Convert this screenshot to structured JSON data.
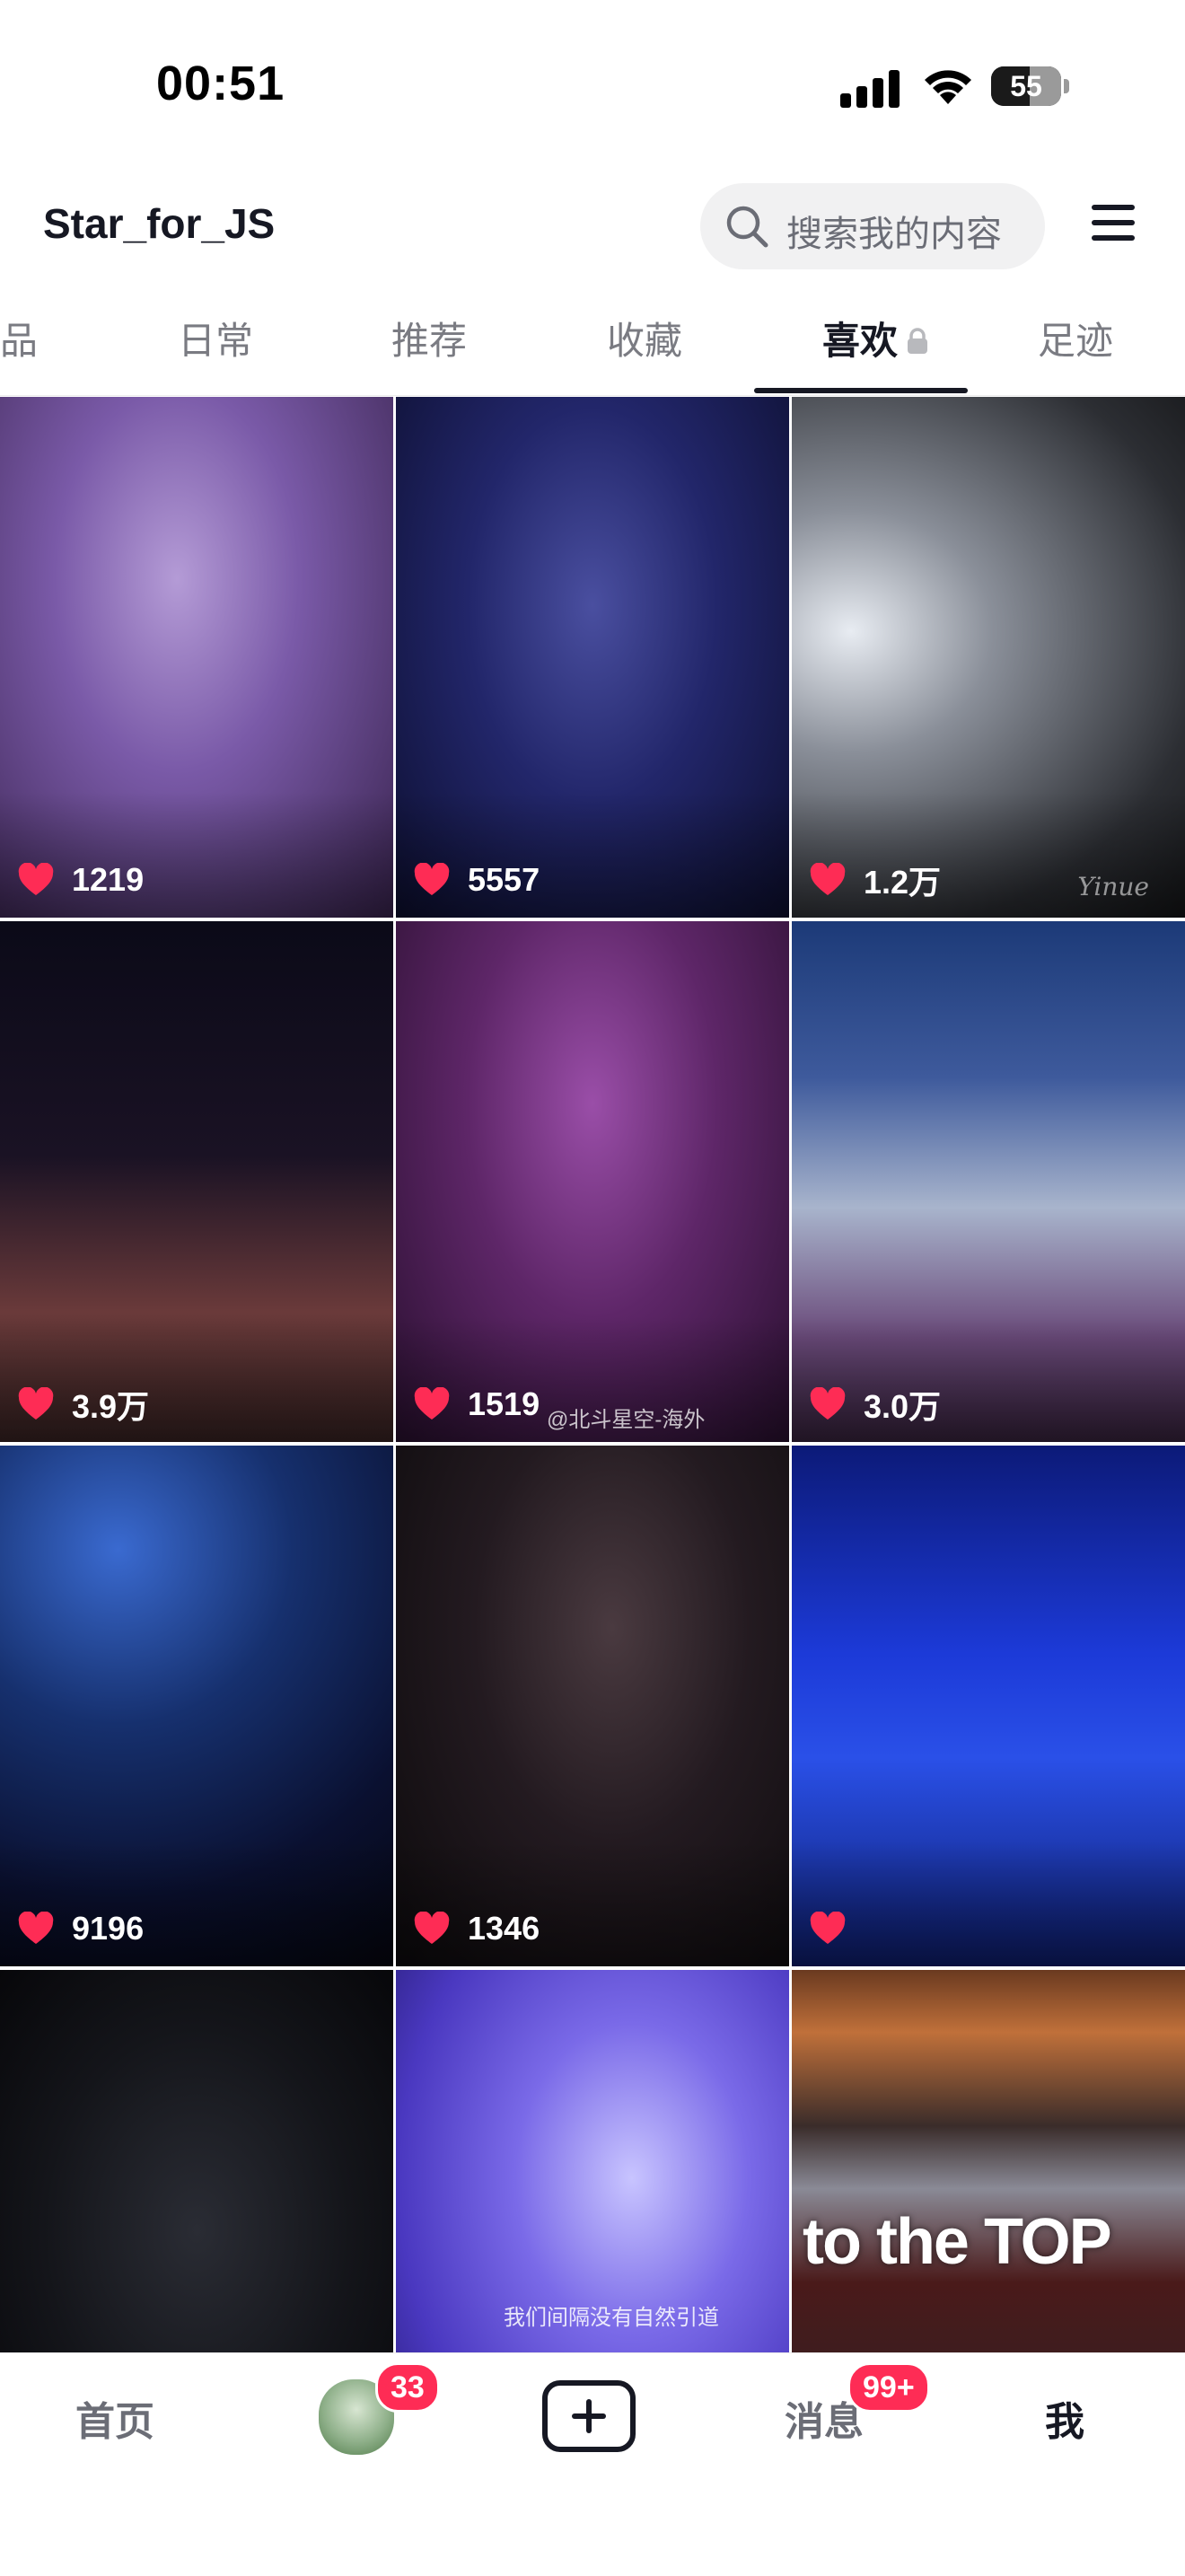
{
  "status_bar": {
    "time": "00:51",
    "battery": "55",
    "battery_level": 0.55
  },
  "header": {
    "username": "Star_for_JS",
    "search_placeholder": "搜索我的内容"
  },
  "tabs": [
    {
      "label": "品",
      "active": false
    },
    {
      "label": "日常",
      "active": false
    },
    {
      "label": "推荐",
      "active": false
    },
    {
      "label": "收藏",
      "active": false
    },
    {
      "label": "喜欢",
      "active": true,
      "locked": true
    },
    {
      "label": "足迹",
      "active": false
    }
  ],
  "grid": {
    "videos": [
      {
        "likes": "1219",
        "theme": "purple-stage"
      },
      {
        "likes": "5557",
        "theme": "blue-stage"
      },
      {
        "likes": "1.2万",
        "theme": "spotlight-gray",
        "watermark": "Yinue"
      },
      {
        "likes": "3.9万",
        "theme": "dark-red-stage"
      },
      {
        "likes": "1519",
        "theme": "purple-dancers",
        "caption": "@北斗星空-海外"
      },
      {
        "likes": "3.0万",
        "theme": "arena-floor"
      },
      {
        "likes": "9196",
        "theme": "blue-lights"
      },
      {
        "likes": "1346",
        "theme": "dark-stage"
      },
      {
        "likes": "",
        "theme": "blue-floor"
      },
      {
        "likes": "",
        "theme": "black-group"
      },
      {
        "likes": "",
        "theme": "violet-closeup",
        "caption": "我们间隔没有自然引道"
      },
      {
        "likes": "",
        "theme": "arena-crowd",
        "overlay_text": "to the TOP"
      }
    ]
  },
  "bottom_nav": {
    "home": "首页",
    "friends_badge": "33",
    "messages": "消息",
    "messages_badge": "99+",
    "me": "我"
  },
  "colors": {
    "accent": "#fe2c55",
    "text": "#161823",
    "muted": "#7a7b82"
  },
  "icons": [
    "signal-icon",
    "wifi-icon",
    "battery-icon",
    "search-icon",
    "menu-icon",
    "lock-icon",
    "heart-icon",
    "plus-icon"
  ]
}
